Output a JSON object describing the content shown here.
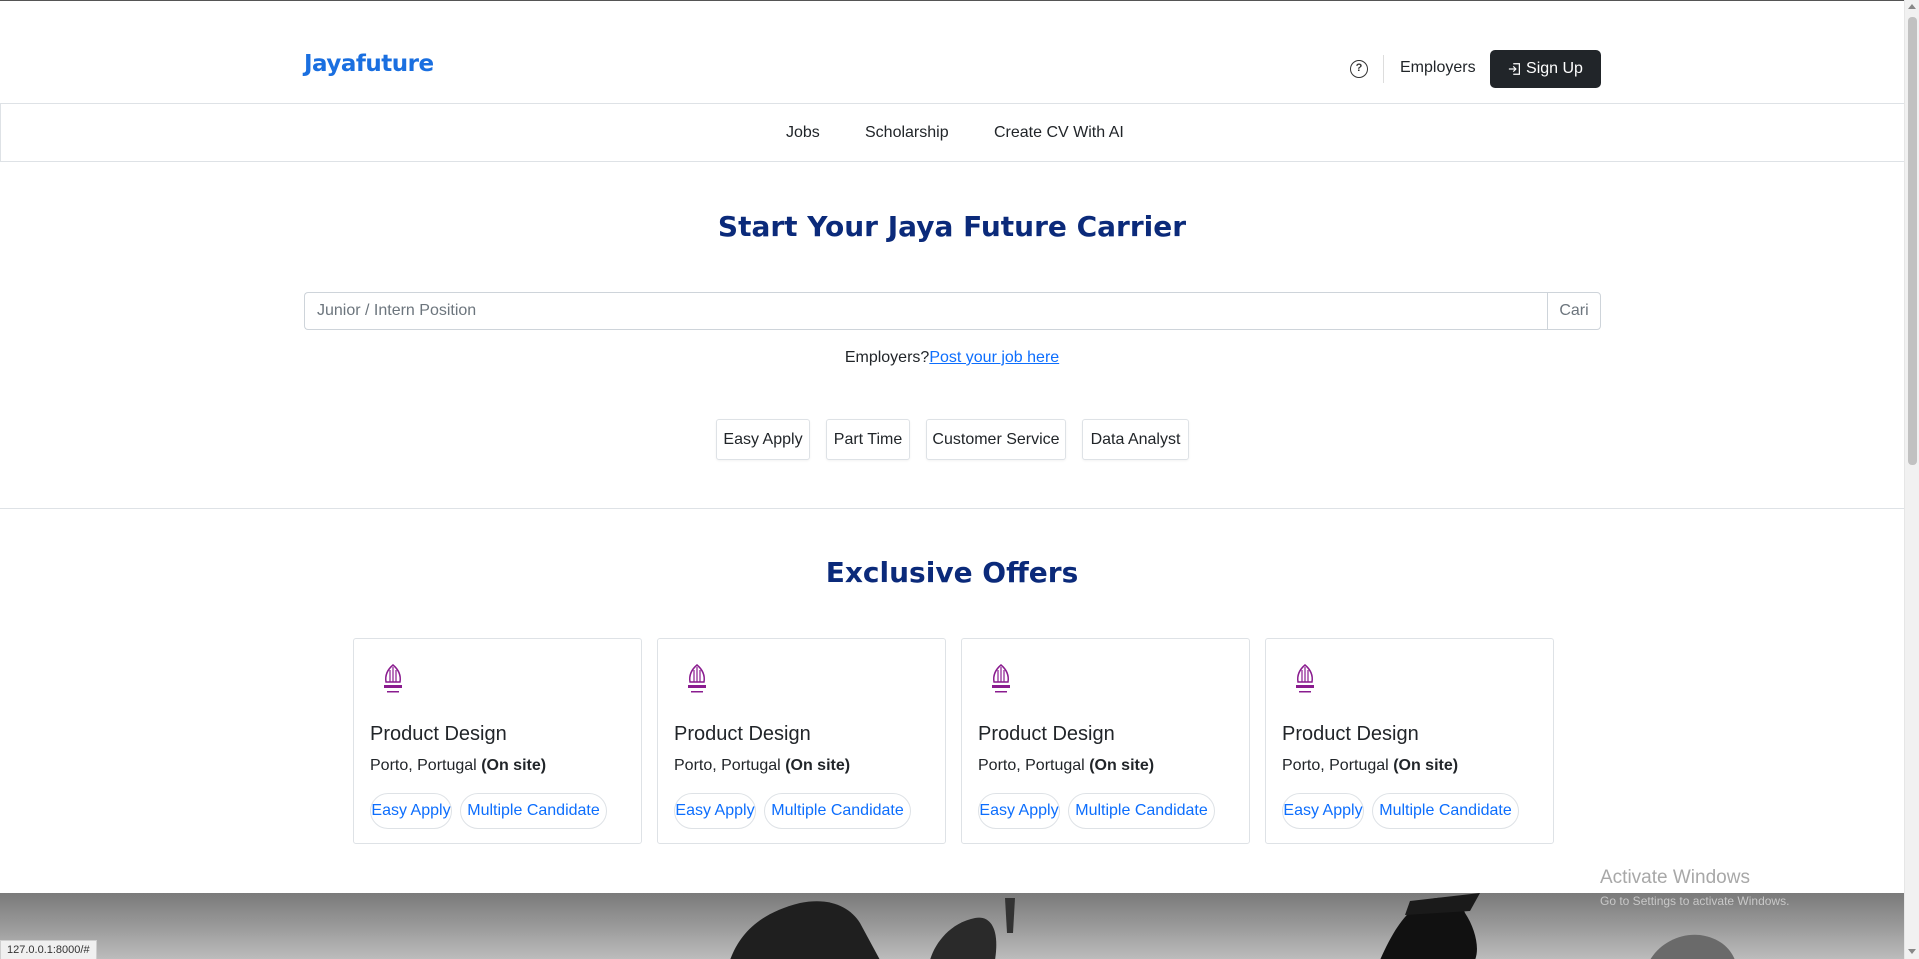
{
  "header": {
    "brand": "Jayafuture",
    "help_icon": "question-circle-icon",
    "employers_label": "Employers",
    "signup_label": "Sign Up",
    "signup_icon": "login-icon"
  },
  "nav": {
    "items": [
      {
        "label": "Jobs"
      },
      {
        "label": "Scholarship"
      },
      {
        "label": "Create CV With AI"
      }
    ]
  },
  "hero": {
    "title": "Start Your Jaya Future Carrier",
    "search_placeholder": "Junior / Intern Position",
    "search_button": "Cari",
    "employer_prompt": "Employers?",
    "employer_link": "Post your job here",
    "tags": [
      {
        "label": "Easy Apply"
      },
      {
        "label": "Part Time"
      },
      {
        "label": "Customer Service"
      },
      {
        "label": "Data Analyst"
      }
    ]
  },
  "offers": {
    "title": "Exclusive Offers",
    "cards": [
      {
        "title": "Product Design",
        "location": "Porto, Portugal",
        "work_type": "(On site)",
        "badges": [
          "Easy Apply",
          "Multiple Candidate"
        ],
        "logo": "halal-logo"
      },
      {
        "title": "Product Design",
        "location": "Porto, Portugal",
        "work_type": "(On site)",
        "badges": [
          "Easy Apply",
          "Multiple Candidate"
        ],
        "logo": "halal-logo"
      },
      {
        "title": "Product Design",
        "location": "Porto, Portugal",
        "work_type": "(On site)",
        "badges": [
          "Easy Apply",
          "Multiple Candidate"
        ],
        "logo": "halal-logo"
      },
      {
        "title": "Product Design",
        "location": "Porto, Portugal",
        "work_type": "(On site)",
        "badges": [
          "Easy Apply",
          "Multiple Candidate"
        ],
        "logo": "halal-logo"
      }
    ]
  },
  "system": {
    "watermark": "Activate Windows",
    "watermark_sub": "Go to Settings to activate Windows.",
    "status_url": "127.0.0.1:8000/#"
  },
  "colors": {
    "brand": "#1a6fe0",
    "heading": "#0b2a7a",
    "link": "#0d6efd",
    "dark_button": "#212529",
    "halal_purple": "#8a1c8f"
  }
}
